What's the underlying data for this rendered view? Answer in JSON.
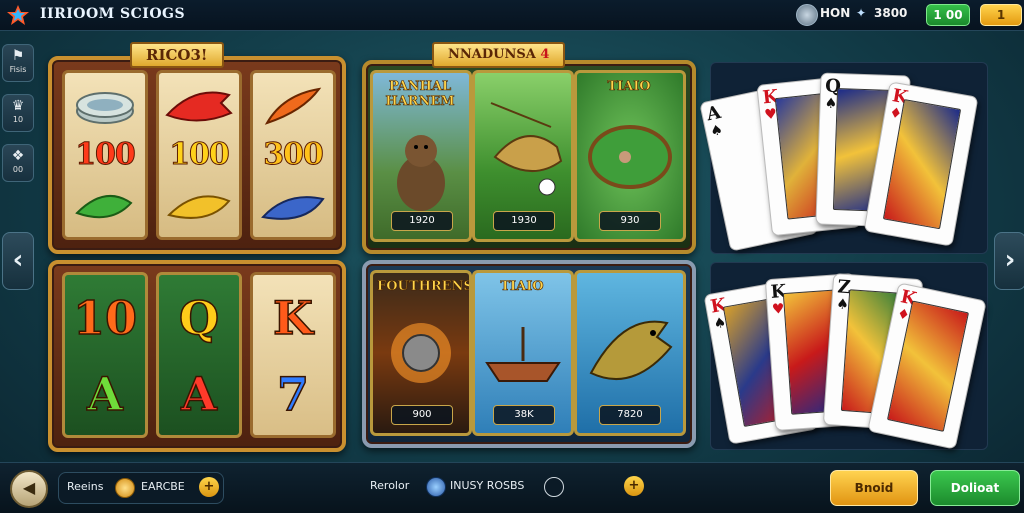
{
  "header": {
    "title": "IIRIOOM SCIOGS",
    "stat_left": "HON",
    "stat_right": "3800",
    "balance_green": "1 00",
    "balance_gold": "1"
  },
  "sidebar": {
    "items": [
      {
        "label": "Fisis",
        "icon": "menu-icon"
      },
      {
        "label": "10",
        "icon": "trophy-icon"
      },
      {
        "label": "00",
        "icon": "gift-icon"
      }
    ]
  },
  "slots_panel": {
    "banner": "RICO3!",
    "reels": [
      {
        "top_symbol": "coin-stack",
        "value": "100",
        "bottom_symbol": "green-fish"
      },
      {
        "top_symbol": "red-fish",
        "value": "100",
        "bottom_symbol": "gold-fish"
      },
      {
        "top_symbol": "carrot",
        "value": "300",
        "bottom_symbol": "blue-fish"
      }
    ]
  },
  "letters_panel": {
    "reels": [
      {
        "top": "10",
        "bottom": "A"
      },
      {
        "top": "Q",
        "bottom": "A"
      },
      {
        "top": "K",
        "bottom": "7"
      }
    ]
  },
  "fishing_panel": {
    "banner": "NNADUNSA",
    "banner_badge": "4",
    "scenes": [
      {
        "title": "PANHAL HARNEM",
        "price": "1920"
      },
      {
        "title": "",
        "price": "1930"
      },
      {
        "title": "TIAIO",
        "price": "930"
      }
    ]
  },
  "water_panel": {
    "scenes": [
      {
        "title": "FOUTHRENS",
        "price": "900"
      },
      {
        "title": "TIAIO",
        "price": "38K"
      },
      {
        "title": "",
        "price": "7820"
      }
    ]
  },
  "cards_top": [
    {
      "rank": "A",
      "suit": "♠"
    },
    {
      "rank": "K",
      "suit": "♥"
    },
    {
      "rank": "Q",
      "suit": "♠"
    },
    {
      "rank": "K",
      "suit": "♦"
    }
  ],
  "cards_bottom": [
    {
      "rank": "K",
      "suit": "♠"
    },
    {
      "rank": "K",
      "suit": "♥"
    },
    {
      "rank": "Z",
      "suit": "♠"
    },
    {
      "rank": "K",
      "suit": "♦"
    }
  ],
  "footer": {
    "left_label": "Reeins",
    "left_value": "EARCBE",
    "mid_label": "Rerolor",
    "mid_value": "INUSY ROSBS",
    "btn_gold": "Bnoid",
    "btn_green": "Dolioat"
  },
  "colors": {
    "accent_gold": "#e0a92e",
    "accent_green": "#1c8b2d",
    "background": "#123c48"
  }
}
